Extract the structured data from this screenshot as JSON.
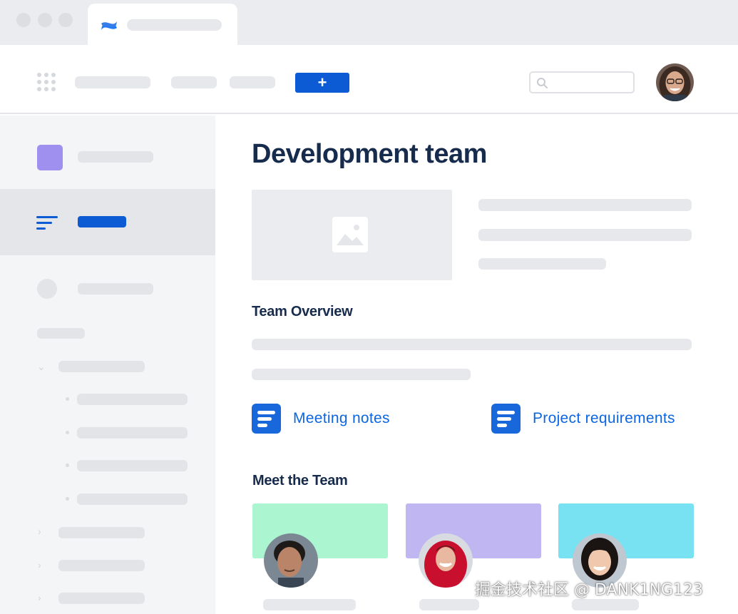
{
  "main": {
    "page_title": "Development team",
    "team_overview_heading": "Team Overview",
    "links": [
      {
        "label": "Meeting notes",
        "icon": "document-icon"
      },
      {
        "label": "Project requirements",
        "icon": "document-icon"
      }
    ],
    "meet_team_heading": "Meet the Team"
  },
  "toolbar": {
    "create_label": "+"
  },
  "colors": {
    "brand_blue": "#0C5AD4",
    "link_blue": "#0C66E4",
    "space_purple": "#9F8FEF",
    "card_green": "#ABF5D1",
    "card_purple": "#C0B6F2",
    "card_cyan": "#79E2F2"
  },
  "watermark": "掘金技术社区 @ DANK1NG123"
}
